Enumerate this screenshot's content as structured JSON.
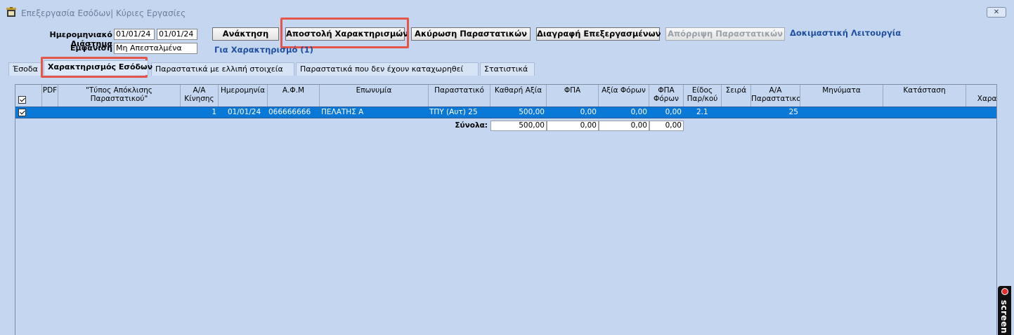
{
  "window": {
    "title": "Επεξεργασία Εσόδων| Κύριες Εργασίες",
    "close_label": "✕"
  },
  "filters": {
    "date_range_label": "Ημερομηνιακό Διάστημα",
    "date_from": "01/01/24",
    "date_to": "01/01/24",
    "display_label": "Εμφάνιση",
    "display_value": "Μη Απεσταλμένα",
    "for_characterization": "Για Χαρακτηρισμό (1)"
  },
  "toolbar": {
    "retrieve": "Ανάκτηση",
    "send_characterizations": "Αποστολή Χαρακτηρισμών",
    "cancel_documents": "Ακύρωση Παραστατικών",
    "delete_processed": "Διαγραφή Επεξεργασμένων",
    "reject_documents": "Απόρριψη Παραστατικών",
    "test_mode": "Δοκιμαστική Λειτουργία"
  },
  "tabs": [
    {
      "label": "Έσοδα"
    },
    {
      "label": "Χαρακτηρισμός Εσόδων"
    },
    {
      "label": "Παραστατικά με ελλιπή στοιχεία"
    },
    {
      "label": "Παραστατικά που δεν έχουν καταχωρηθεί"
    },
    {
      "label": "Στατιστικά"
    }
  ],
  "grid": {
    "columns": [
      {
        "label": ""
      },
      {
        "label": "PDF"
      },
      {
        "label": "\"Τύπος Απόκλισης Παραστατικού\""
      },
      {
        "label": "Α/Α Κίνησης"
      },
      {
        "label": "Ημερομηνία"
      },
      {
        "label": "Α.Φ.Μ"
      },
      {
        "label": "Επωνυμία"
      },
      {
        "label": "Παραστατικό"
      },
      {
        "label": "Καθαρή Αξία"
      },
      {
        "label": "ΦΠΑ"
      },
      {
        "label": "Αξία Φόρων"
      },
      {
        "label": "ΦΠΑ Φόρων"
      },
      {
        "label": "Είδος Παρ/κού"
      },
      {
        "label": "Σειρά"
      },
      {
        "label": "Α/Α Παραστατικού"
      },
      {
        "label": "Μηνύματα"
      },
      {
        "label": "Κατάσταση"
      },
      {
        "label": "\"Μ Χαρακτ"
      }
    ],
    "rows": [
      {
        "checked": true,
        "pdf": "",
        "deviation_type": "",
        "movement_no": "1",
        "date": "01/01/24",
        "afm": "066666666",
        "name": "ΠΕΛΑΤΗΣ Α",
        "document": "ΤΠΥ (Αυτ) 25",
        "net_value": "500,00",
        "vat": "0,00",
        "taxes": "0,00",
        "tax_vat": "0,00",
        "doc_kind": "2.1",
        "series": "",
        "doc_no": "25",
        "messages": "",
        "status": ""
      }
    ],
    "totals": {
      "label": "Σύνολα:",
      "net_value": "500,00",
      "vat": "0,00",
      "taxes": "0,00",
      "tax_vat": "0,00"
    }
  },
  "recorder": {
    "label": "screen"
  },
  "colors": {
    "background": "#c5d7f0",
    "selected_row": "#0a78d7",
    "highlight_box": "#e4564a",
    "link_blue": "#1f4fa3"
  }
}
